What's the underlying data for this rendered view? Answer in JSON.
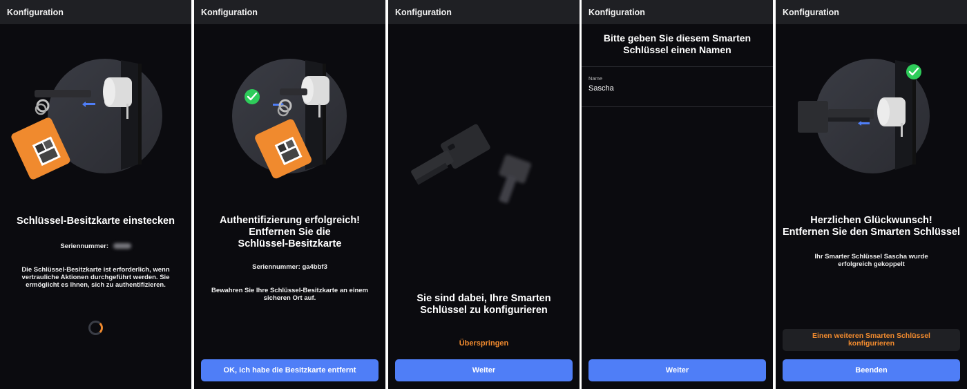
{
  "screens": [
    {
      "header": "Konfiguration",
      "title": "Schlüssel-Besitzkarte einstecken",
      "serial_label": "Seriennummer:",
      "body": "Die Schlüssel-Besitzkarte ist erforderlich, wenn vertrauliche Aktionen durchgeführt werden. Sie ermöglicht es Ihnen, sich zu authentifizieren."
    },
    {
      "header": "Konfiguration",
      "title_line1": "Authentifizierung erfolgreich!",
      "title_line2": "Entfernen Sie die",
      "title_line3": "Schlüssel-Besitzkarte",
      "serial_label": "Seriennummer:",
      "serial_value": "ga4bbf3",
      "body": "Bewahren Sie Ihre Schlüssel-Besitzkarte an einem sicheren Ort auf.",
      "button": "OK, ich habe die Besitzkarte entfernt"
    },
    {
      "header": "Konfiguration",
      "title_line1": "Sie sind dabei, Ihre Smarten",
      "title_line2": "Schlüssel zu konfigurieren",
      "skip": "Überspringen",
      "button": "Weiter"
    },
    {
      "header": "Konfiguration",
      "title_line1": "Bitte geben Sie diesem Smarten",
      "title_line2": "Schlüssel einen Namen",
      "field_label": "Name",
      "field_value": "Sascha",
      "button": "Weiter"
    },
    {
      "header": "Konfiguration",
      "title_line1": "Herzlichen Glückwunsch!",
      "title_line2": "Entfernen Sie den Smarten Schlüssel",
      "body": "Ihr Smarter Schlüssel Sascha wurde erfolgreich gekoppelt",
      "secondary_button": "Einen weiteren Smarten Schlüssel konfigurieren",
      "button": "Beenden"
    }
  ],
  "colors": {
    "background": "#0b0b0f",
    "header": "#1f2024",
    "primary": "#4f7ef7",
    "accent": "#f08a2e",
    "success": "#2ecc5a"
  },
  "icons": [
    "loading-spinner-icon",
    "check-icon",
    "key-icon",
    "key-card-icon",
    "lock-cylinder-icon"
  ]
}
